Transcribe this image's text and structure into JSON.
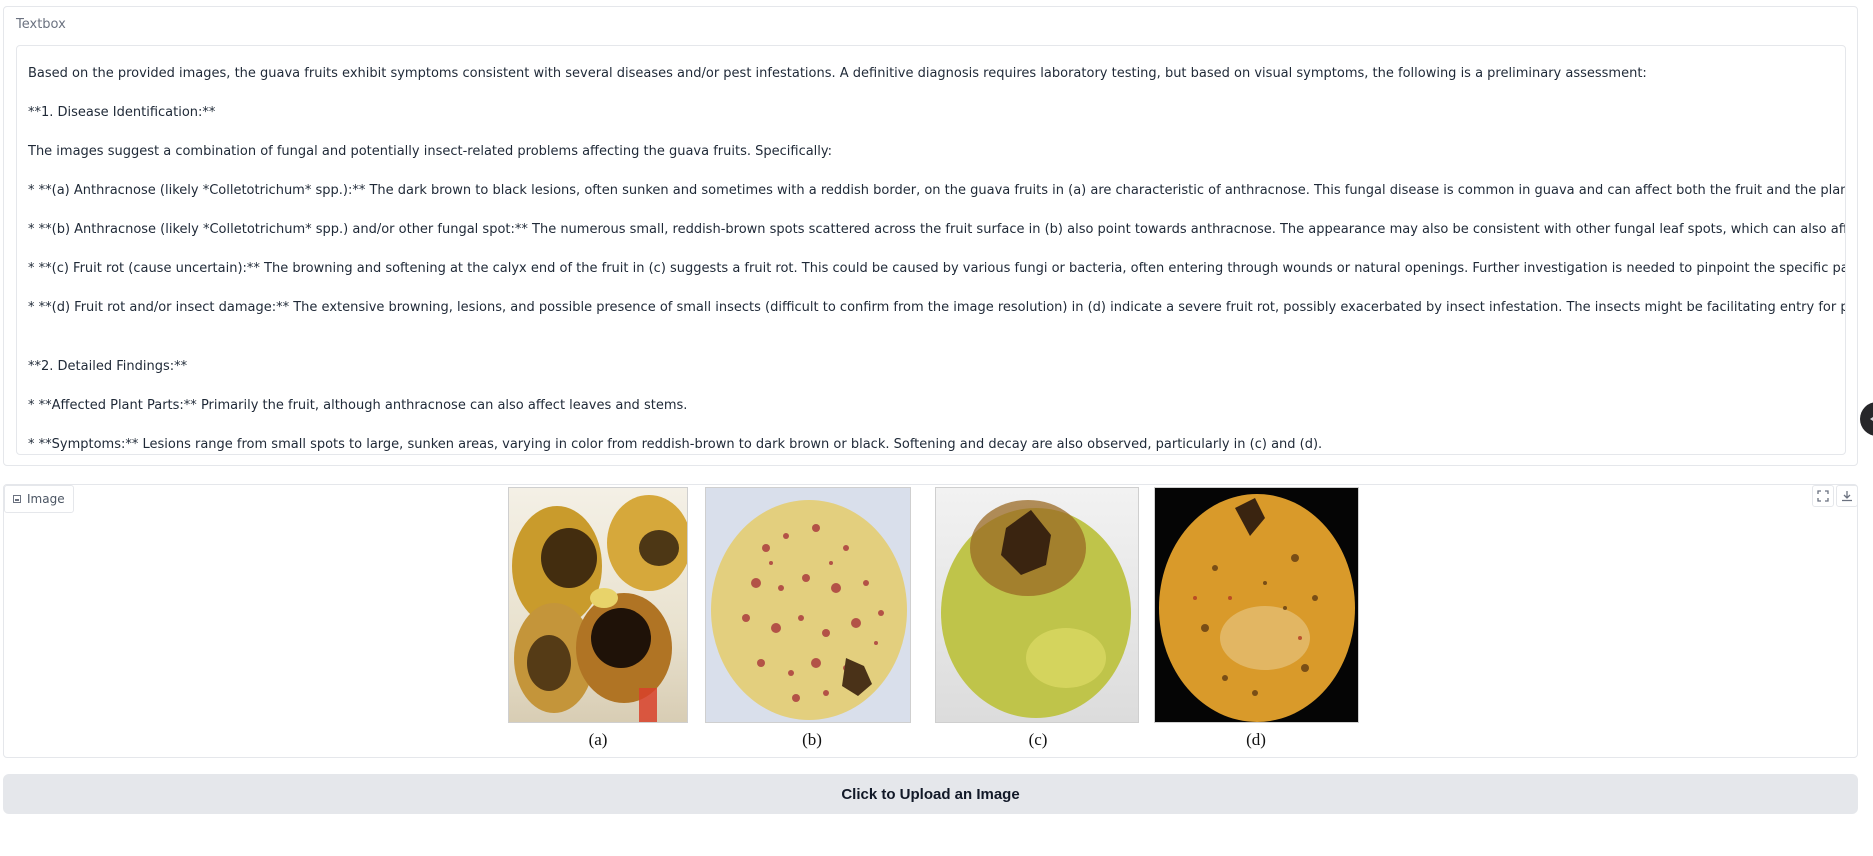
{
  "textbox": {
    "label": "Textbox",
    "lines": [
      "Based on the provided images, the guava fruits exhibit symptoms consistent with several diseases and/or pest infestations.  A definitive diagnosis requires laboratory testing, but based on visual symptoms, the following is a preliminary assessment:",
      "**1. Disease Identification:**",
      "The images suggest a combination of fungal and potentially insect-related problems affecting the guava fruits.  Specifically:",
      "* **(a) Anthracnose (likely *Colletotrichum* spp.):** The dark brown to black lesions, often sunken and sometimes with a reddish border, on the guava fruits in (a) are characteristic of anthracnose. This fungal disease is common in guava and can affect both the fruit and the plant itself.",
      "* **(b) Anthracnose (likely *Colletotrichum* spp.) and/or other fungal spot:** The numerous small, reddish-brown spots scattered across the fruit surface in (b) also point towards anthracnose. The appearance may also be consistent with other fungal leaf spots, which can also affect the fruit.",
      "* **(c) Fruit rot (cause uncertain):** The browning and softening at the calyx end of the fruit in (c) suggests a fruit rot.  This could be caused by various fungi or bacteria, often entering through wounds or natural openings.  Further investigation is needed to pinpoint the specific pathogen.",
      "* **(d) Fruit rot and/or insect damage:** The extensive browning, lesions, and possible presence of small insects (difficult to confirm from the image resolution) in (d) indicate a severe fruit rot, possibly exacerbated by insect infestation.  The insects might be facilitating entry for pathogens.",
      "",
      "**2. Detailed Findings:**",
      "* **Affected Plant Parts:** Primarily the fruit, although anthracnose can also affect leaves and stems.",
      "* **Symptoms:**  Lesions range from small spots to large, sunken areas, varying in color from reddish-brown to dark brown or black.  Softening and decay are also observed, particularly in (c) and (d)."
    ]
  },
  "image_panel": {
    "label": "Image",
    "captions": [
      "(a)",
      "(b)",
      "(c)",
      "(d)"
    ]
  },
  "upload_button": {
    "label": "Click to Upload an Image"
  },
  "colors": {
    "button_bg": "#e5e7eb",
    "border": "#e5e7eb",
    "guava_yellow": "#d9c24a",
    "lesion_brown": "#6b3d14",
    "spot_red": "#a8343a"
  },
  "icons": {
    "image_label": "image-icon",
    "fullscreen": "fullscreen-icon",
    "download": "download-icon",
    "scroll_knob": "chevron-left-icon"
  }
}
